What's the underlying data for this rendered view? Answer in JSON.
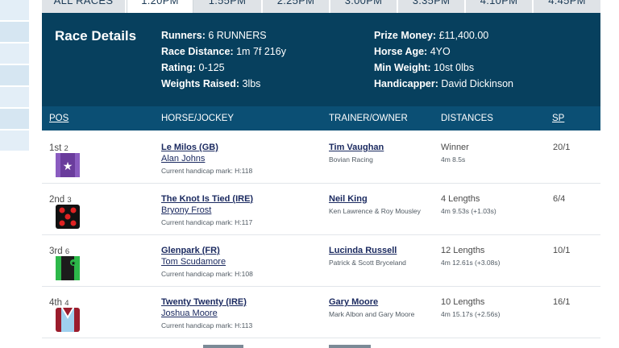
{
  "tabs": [
    {
      "label": "ALL RACES",
      "active": false
    },
    {
      "label": "1:20PM",
      "active": true
    },
    {
      "label": "1:55PM",
      "active": false
    },
    {
      "label": "2:25PM",
      "active": false
    },
    {
      "label": "3:00PM",
      "active": false
    },
    {
      "label": "3:35PM",
      "active": false
    },
    {
      "label": "4:10PM",
      "active": false
    },
    {
      "label": "4:45PM",
      "active": false
    }
  ],
  "race_details": {
    "title": "Race Details",
    "runners_label": "Runners:",
    "runners_value": "6 RUNNERS",
    "distance_label": "Race Distance:",
    "distance_value": "1m 7f 216y",
    "rating_label": "Rating:",
    "rating_value": "0-125",
    "weights_label": "Weights Raised:",
    "weights_value": "3lbs",
    "prize_label": "Prize Money:",
    "prize_value": "£11,400.00",
    "age_label": "Horse Age:",
    "age_value": "4YO",
    "minweight_label": "Min Weight:",
    "minweight_value": "10st 0lbs",
    "handicapper_label": "Handicapper:",
    "handicapper_value": "David Dickinson"
  },
  "table_headers": {
    "pos": "POS",
    "horse_jockey": "HORSE/JOCKEY",
    "trainer_owner": "TRAINER/OWNER",
    "distances": "DISTANCES",
    "sp": "SP"
  },
  "rows": [
    {
      "pos": "1st",
      "draw": "2",
      "horse": "Le Milos (GB)",
      "jockey": "Alan Johns",
      "mark": "Current handicap mark: H:118",
      "trainer": "Tim Vaughan",
      "owner": "Bovian Racing",
      "distance": "Winner",
      "time": "4m 8.5s",
      "sp": "20/1",
      "silk_color": "#6a3c9c"
    },
    {
      "pos": "2nd",
      "draw": "3",
      "horse": "The Knot Is Tied (IRE)",
      "jockey": "Bryony Frost",
      "mark": "Current handicap mark: H:117",
      "trainer": "Neil King",
      "owner": "Ken Lawrence & Roy Mousley",
      "distance": "4 Lengths",
      "time": "4m 9.53s (+1.03s)",
      "sp": "6/4",
      "silk_color": "#111111"
    },
    {
      "pos": "3rd",
      "draw": "6",
      "horse": "Glenpark (FR)",
      "jockey": "Tom Scudamore",
      "mark": "Current handicap mark: H:108",
      "trainer": "Lucinda Russell",
      "owner": "Patrick & Scott Bryceland",
      "distance": "12 Lengths",
      "time": "4m 12.61s (+3.08s)",
      "sp": "10/1",
      "silk_color": "#1c1c1c"
    },
    {
      "pos": "4th",
      "draw": "4",
      "horse": "Twenty Twenty (IRE)",
      "jockey": "Joshua Moore",
      "mark": "Current handicap mark: H:113",
      "trainer": "Gary Moore",
      "owner": "Mark Albon and Gary Moore",
      "distance": "10 Lengths",
      "time": "4m 15.17s (+2.56s)",
      "sp": "16/1",
      "silk_color": "#9b1c2c"
    }
  ]
}
